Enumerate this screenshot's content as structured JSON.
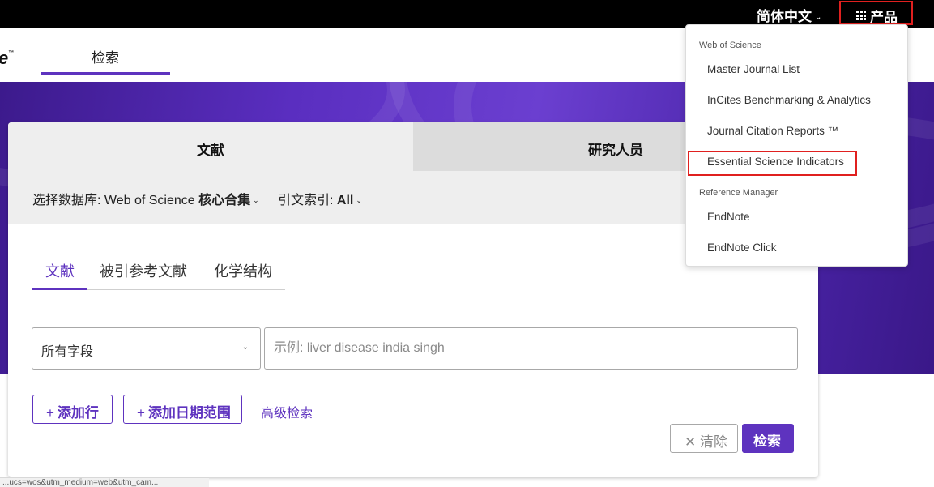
{
  "topbar": {
    "language": "简体中文",
    "products_label": "产品"
  },
  "nav": {
    "logo_fragment": "e",
    "logo_tm": "™",
    "search_tab": "检索"
  },
  "card": {
    "tab_documents": "文献",
    "tab_researchers": "研究人员",
    "database_label": "选择数据库:",
    "database_name": "Web of Science",
    "database_collection": "核心合集",
    "citation_index_label": "引文索引:",
    "citation_index_value": "All",
    "sub_tabs": [
      "文献",
      "被引参考文献",
      "化学结构"
    ],
    "field_select": "所有字段",
    "search_placeholder": "示例: liver disease india singh",
    "add_row": "添加行",
    "add_date_range": "添加日期范围",
    "advanced_search": "高级检索",
    "clear": "清除",
    "search": "检索"
  },
  "products_menu": {
    "group1_heading": "Web of Science",
    "group1_items": [
      "Master Journal List",
      "InCites Benchmarking & Analytics",
      "Journal Citation Reports ™",
      "Essential Science Indicators"
    ],
    "group2_heading": "Reference Manager",
    "group2_items": [
      "EndNote",
      "EndNote Click"
    ]
  },
  "status_bar": {
    "url_fragment": "...ucs=wos&utm_medium=web&utm_cam..."
  },
  "colors": {
    "accent": "#5e33bf",
    "highlight_red": "#e0201f",
    "topbar": "#000000"
  },
  "icons": [
    "grid-icon",
    "chevron-down-icon",
    "plus-icon",
    "close-icon"
  ]
}
